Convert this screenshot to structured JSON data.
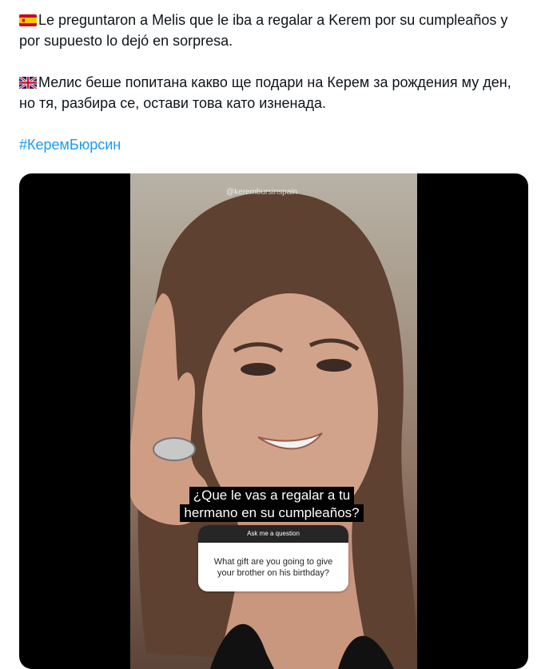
{
  "tweet": {
    "spanish_flag_icon": "spain-flag-icon",
    "spanish_text": "Le preguntaron a Melis que le iba a regalar a Kerem por su cumpleaños y por supuesto lo dejó en sorpresa.",
    "uk_flag_icon": "uk-flag-icon",
    "bulgarian_text": "Мелис беше попитана какво ще подари на Керем за рождения му ден, но тя, разбира се, остави това като изненада.",
    "hashtag": "#КеремБюрсин"
  },
  "video": {
    "watermark": "@kerembursinspain",
    "caption_line1": "¿Que le vas a regalar a tu",
    "caption_line2": "hermano en su cumpleaños?",
    "question_header": "Ask me a question",
    "question_text": "What gift are you going to give your brother on his birthday?"
  }
}
